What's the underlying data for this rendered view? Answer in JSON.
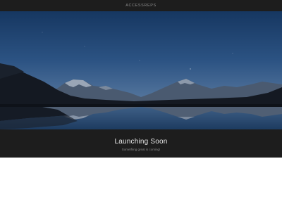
{
  "header": {
    "brand": "ACCESSREPS"
  },
  "hero": {
    "image_description_icon": "mountain-lake-night-image"
  },
  "footer": {
    "headline": "Launching Soon",
    "subline": "Something great is coming!"
  },
  "colors": {
    "bar_background": "#1d1d1d",
    "sky_top": "#163761",
    "sky_bottom": "#4d6f98",
    "page_background": "#ffffff"
  }
}
